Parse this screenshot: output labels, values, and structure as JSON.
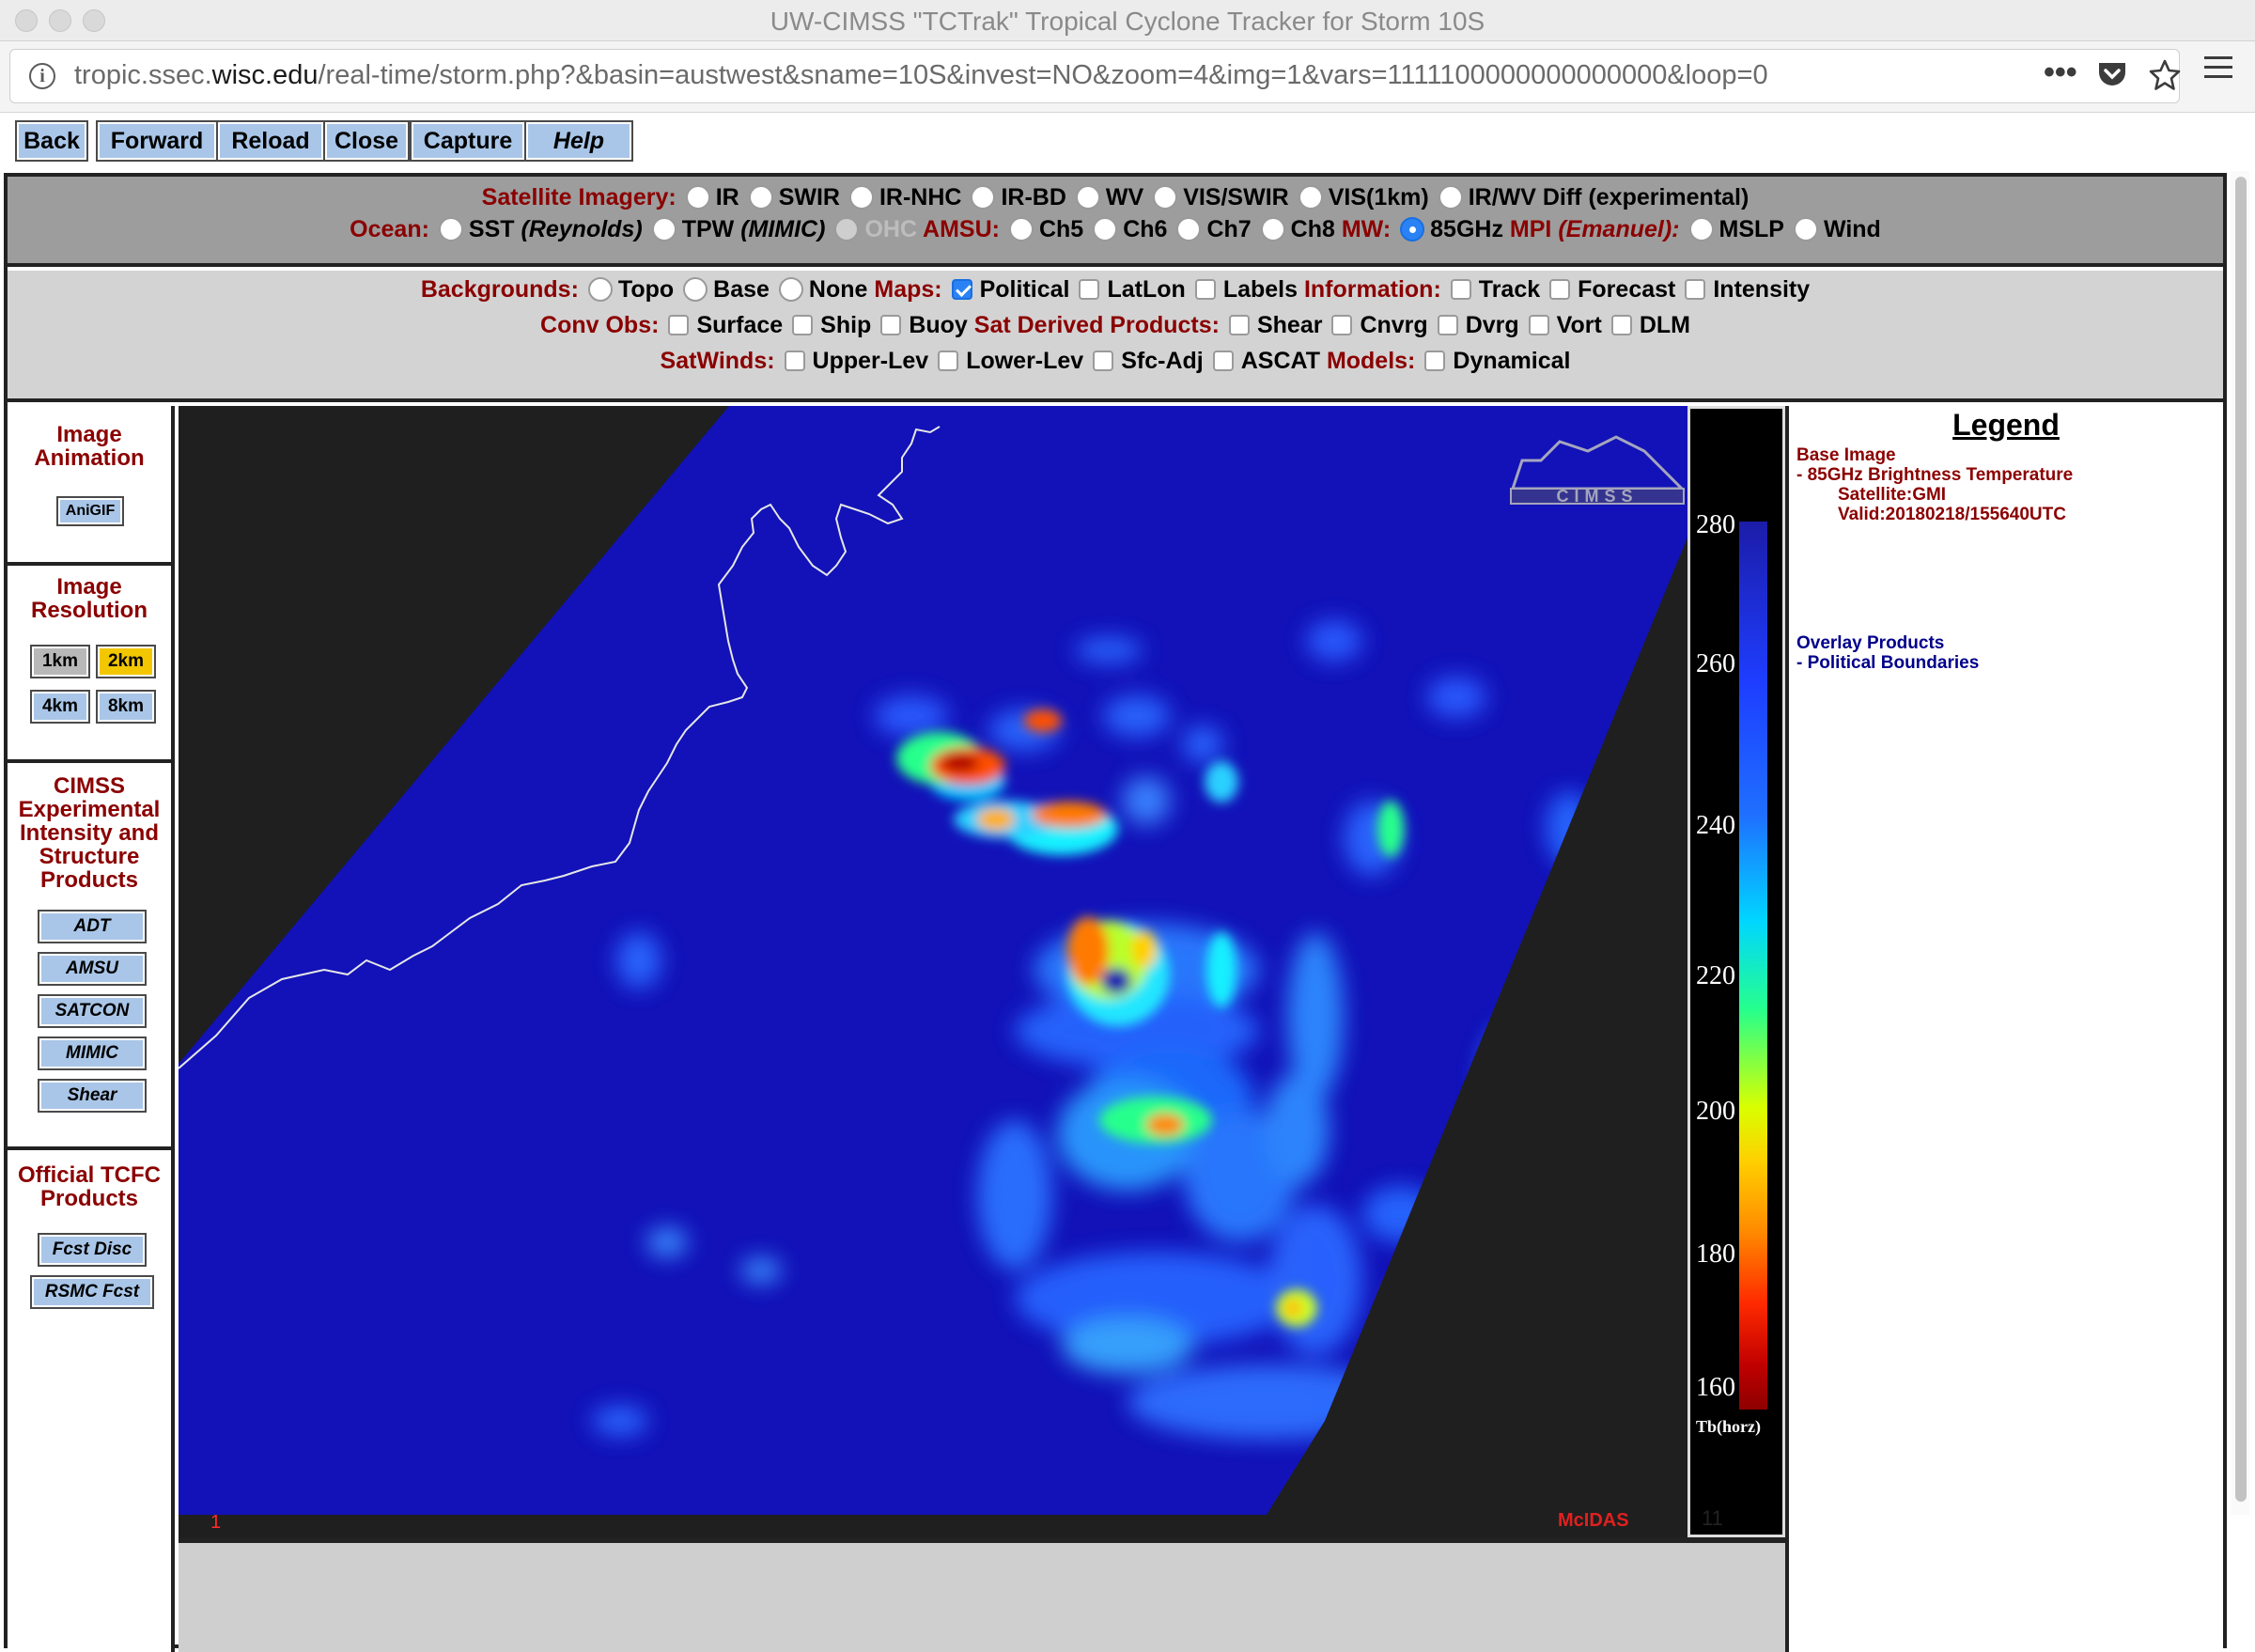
{
  "window": {
    "title": "UW-CIMSS \"TCTrak\" Tropical Cyclone Tracker for Storm 10S"
  },
  "urlbar": {
    "prefix": "tropic.ssec.",
    "domain": "wisc.edu",
    "path": "/real-time/storm.php?&basin=austwest&sname=10S&invest=NO&zoom=4&img=1&vars=1111100000000000000&loop=0"
  },
  "page_buttons": [
    "Back",
    "Forward",
    "Reload",
    "Close",
    "Capture",
    "Help"
  ],
  "row1": {
    "label": "Satellite Imagery:",
    "options": [
      "IR",
      "SWIR",
      "IR-NHC",
      "IR-BD",
      "WV",
      "VIS/SWIR",
      "VIS(1km)",
      "IR/WV Diff (experimental)"
    ]
  },
  "row2": {
    "ocean_label": "Ocean:",
    "sst": "SST",
    "sst_src": "(Reynolds)",
    "tpw": "TPW",
    "tpw_src": "(MIMIC)",
    "ohc": "OHC",
    "amsu_label": "AMSU:",
    "amsu_options": [
      "Ch5",
      "Ch6",
      "Ch7",
      "Ch8"
    ],
    "mw_label": "MW:",
    "mw_option": "85GHz",
    "mpi_label": "MPI",
    "mpi_src": "(Emanuel):",
    "mpi_options": [
      "MSLP",
      "Wind"
    ]
  },
  "row3": {
    "bg_label": "Backgrounds:",
    "bg_options": [
      "Topo",
      "Base",
      "None"
    ],
    "maps_label": "Maps:",
    "maps_options": [
      "Political",
      "LatLon",
      "Labels"
    ],
    "info_label": "Information:",
    "info_options": [
      "Track",
      "Forecast",
      "Intensity"
    ]
  },
  "row4": {
    "conv_label": "Conv Obs:",
    "conv_options": [
      "Surface",
      "Ship",
      "Buoy"
    ],
    "sat_label": "Sat Derived Products:",
    "sat_options": [
      "Shear",
      "Cnvrg",
      "Dvrg",
      "Vort",
      "DLM"
    ]
  },
  "row5": {
    "winds_label": "SatWinds:",
    "winds_options": [
      "Upper-Lev",
      "Lower-Lev",
      "Sfc-Adj",
      "ASCAT"
    ],
    "models_label": "Models:",
    "models_options": [
      "Dynamical"
    ]
  },
  "sidebar": {
    "anim_title_1": "Image",
    "anim_title_2": "Animation",
    "anigif": "AniGIF",
    "res_title_1": "Image",
    "res_title_2": "Resolution",
    "res_options": [
      "1km",
      "2km",
      "4km",
      "8km"
    ],
    "cimss_title": [
      "CIMSS",
      "Experimental",
      "Intensity and",
      "Structure",
      "Products"
    ],
    "cimss_buttons": [
      "ADT",
      "AMSU",
      "SATCON",
      "MIMIC",
      "Shear"
    ],
    "tcfc_title": [
      "Official TCFC",
      "Products"
    ],
    "tcfc_buttons": [
      "Fcst Disc",
      "RSMC Fcst"
    ]
  },
  "image": {
    "frame_number": "1",
    "mcidas_label": "McIDAS",
    "logo": "CIMSS",
    "colorbar_ticks": [
      "280",
      "260",
      "240",
      "220",
      "200",
      "180",
      "160"
    ],
    "colorbar_unit": "Tb(horz)",
    "corner_number": "11"
  },
  "legend": {
    "title": "Legend",
    "base_header": "Base Image",
    "base_item": "-  85GHz Brightness Temperature",
    "satellite": "Satellite:GMI",
    "valid": "Valid:20180218/155640UTC",
    "overlay_header": "Overlay Products",
    "overlay_item": "-  Political Boundaries"
  },
  "colors": {
    "selected_res": "#f2c700",
    "button": "#a9c6e8",
    "label_red": "#8b0000",
    "legend_blue": "#00008b"
  }
}
